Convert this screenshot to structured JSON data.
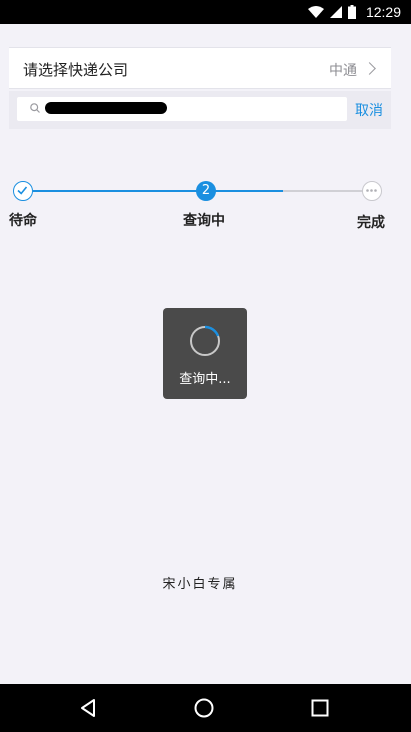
{
  "status_bar": {
    "time": "12:29"
  },
  "company_selector": {
    "label": "请选择快递公司",
    "value": "中通"
  },
  "search": {
    "value": "",
    "placeholder": "",
    "cancel_label": "取消"
  },
  "steps": [
    {
      "label": "待命",
      "state": "done"
    },
    {
      "label": "查询中",
      "number": "2",
      "state": "active"
    },
    {
      "label": "完成",
      "state": "pending"
    }
  ],
  "loading_toast": {
    "text": "查询中..."
  },
  "footer": {
    "text": "宋小白专属"
  },
  "colors": {
    "accent": "#1a8fe0",
    "background": "#f3f2f8",
    "pending": "#c8c8cd"
  }
}
